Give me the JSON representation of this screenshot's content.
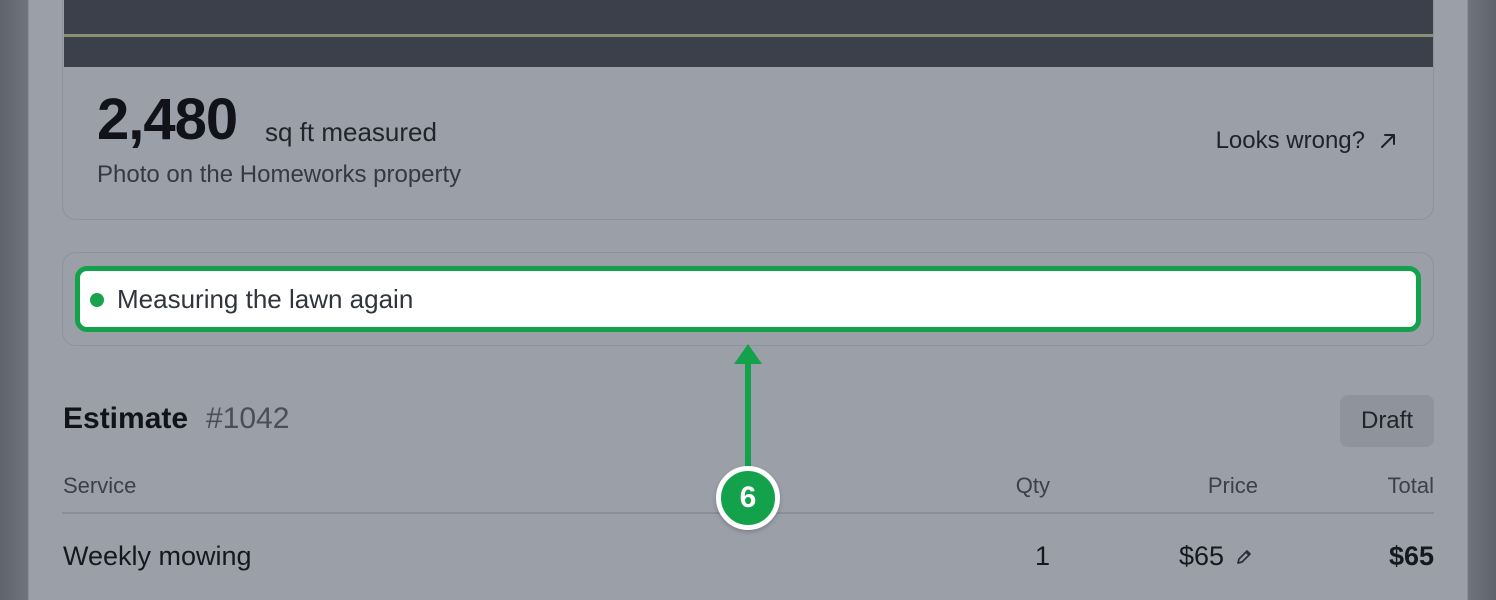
{
  "measurement": {
    "value": "2,480",
    "unit": "sq ft measured",
    "subtitle": "Photo on the Homeworks property",
    "report_link": "Looks wrong?"
  },
  "status": {
    "text": "Measuring the lawn again"
  },
  "estimate": {
    "title": "Estimate",
    "number": "#1042",
    "badge": "Draft",
    "columns": [
      "Service",
      "Qty",
      "Price",
      "Total"
    ],
    "rows": [
      {
        "service": "Weekly mowing",
        "qty": "1",
        "price": "$65",
        "total": "$65"
      }
    ]
  },
  "annotation": {
    "step": "6"
  },
  "colors": {
    "accent": "#13a14c",
    "overlay": "#9b9fa8",
    "map_dark": "#3b404a"
  },
  "icons": {
    "report": "arrow-up-right-icon",
    "edit": "pencil-icon",
    "status": "status-dot-icon"
  }
}
